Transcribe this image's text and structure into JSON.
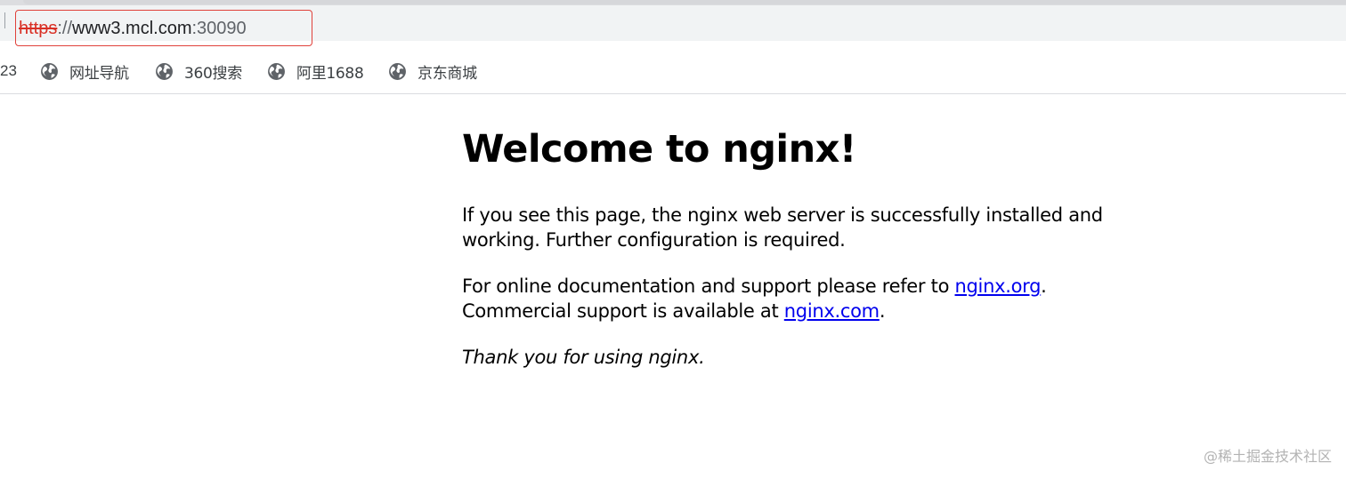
{
  "browser": {
    "address_bar": {
      "scheme": "https",
      "separator": "://",
      "host": "www3.mcl.com",
      "port_sep": ":",
      "port": "30090"
    },
    "bookmarks": {
      "partial_label": "23",
      "items": [
        {
          "label": "网址导航",
          "icon": "globe-icon"
        },
        {
          "label": "360搜索",
          "icon": "globe-icon"
        },
        {
          "label": "阿里1688",
          "icon": "globe-icon"
        },
        {
          "label": "京东商城",
          "icon": "globe-icon"
        }
      ]
    }
  },
  "page": {
    "title": "Welcome to nginx!",
    "paragraph1": "If you see this page, the nginx web server is successfully installed and working. Further configuration is required.",
    "paragraph2": {
      "text_a": "For online documentation and support please refer to ",
      "link1": "nginx.org",
      "text_b": ".",
      "text_c": "Commercial support is available at ",
      "link2": "nginx.com",
      "text_d": "."
    },
    "paragraph3": "Thank you for using nginx."
  },
  "watermark": "@稀土掘金技术社区",
  "colors": {
    "highlight_border": "#e0413a",
    "insecure_scheme": "#d93025",
    "link": "#0000ee"
  }
}
